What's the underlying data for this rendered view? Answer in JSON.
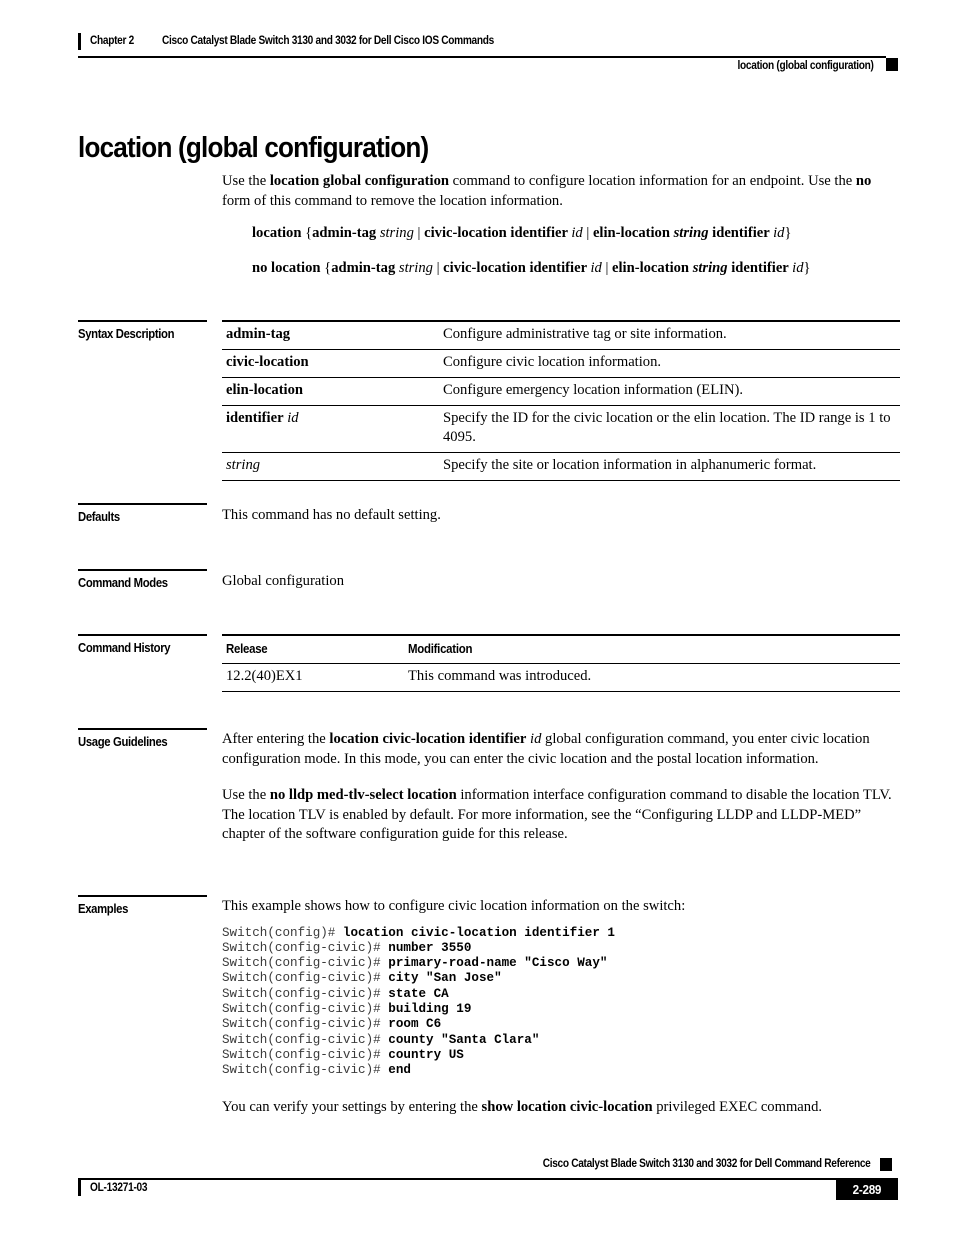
{
  "header": {
    "chapter": "Chapter 2",
    "chapter_title": "Cisco Catalyst Blade Switch 3130 and 3032 for Dell Cisco IOS Commands",
    "running_head": "location (global configuration)"
  },
  "page_title": "location (global configuration)",
  "intro": {
    "part1": "Use the ",
    "bold1": "location global configuration",
    "part2": " command to configure location information for an endpoint. Use the ",
    "bold2": "no",
    "part3": " form of this command to remove the location information."
  },
  "syntax_lines": [
    {
      "id": "syntax-positive",
      "segments": [
        {
          "text": "location ",
          "style": "bold"
        },
        {
          "text": "{",
          "style": "normal"
        },
        {
          "text": "admin-tag ",
          "style": "bold"
        },
        {
          "text": "string",
          "style": "italic"
        },
        {
          "text": " | ",
          "style": "normal"
        },
        {
          "text": "civic-location identifier ",
          "style": "bold"
        },
        {
          "text": "id",
          "style": "italic"
        },
        {
          "text": " | ",
          "style": "normal"
        },
        {
          "text": "elin-location ",
          "style": "bold"
        },
        {
          "text": "string",
          "style": "bolditalic"
        },
        {
          "text": " identifier ",
          "style": "bold"
        },
        {
          "text": "id",
          "style": "italic"
        },
        {
          "text": "}",
          "style": "normal"
        }
      ]
    },
    {
      "id": "syntax-negative",
      "segments": [
        {
          "text": "no location ",
          "style": "bold"
        },
        {
          "text": "{",
          "style": "normal"
        },
        {
          "text": "admin-tag ",
          "style": "bold"
        },
        {
          "text": "string",
          "style": "italic"
        },
        {
          "text": " | ",
          "style": "normal"
        },
        {
          "text": "civic-location identifier ",
          "style": "bold"
        },
        {
          "text": "id",
          "style": "italic"
        },
        {
          "text": " | ",
          "style": "normal"
        },
        {
          "text": "elin-location ",
          "style": "bold"
        },
        {
          "text": "string",
          "style": "bolditalic"
        },
        {
          "text": " identifier ",
          "style": "bold"
        },
        {
          "text": "id",
          "style": "italic"
        },
        {
          "text": "}",
          "style": "normal"
        }
      ]
    }
  ],
  "sections": {
    "syntax_description": {
      "label": "Syntax Description",
      "rows": [
        {
          "term": "admin-tag",
          "term_italic_suffix": "",
          "description": "Configure administrative tag or site information."
        },
        {
          "term": "civic-location",
          "term_italic_suffix": "",
          "description": "Configure civic location information."
        },
        {
          "term": "elin-location",
          "term_italic_suffix": "",
          "description": "Configure emergency location information (ELIN)."
        },
        {
          "term": "identifier",
          "term_italic_suffix": "id",
          "description": "Specify the ID for the civic location or the elin location. The ID range is 1 to 4095."
        },
        {
          "term_italic_only": "string",
          "description": "Specify the site or location information in alphanumeric format."
        }
      ]
    },
    "defaults": {
      "label": "Defaults",
      "text": "This command has no default setting."
    },
    "command_modes": {
      "label": "Command Modes",
      "text": "Global configuration"
    },
    "command_history": {
      "label": "Command History",
      "columns": [
        "Release",
        "Modification"
      ],
      "rows": [
        {
          "release": "12.2(40)EX1",
          "modification": "This command was introduced."
        }
      ]
    },
    "usage_guidelines": {
      "label": "Usage Guidelines",
      "paragraph1": {
        "part1": "After entering the ",
        "bold1": "location civic-location identifier",
        "italic1": " id",
        "part2": " global configuration command, you enter civic location configuration mode. In this mode, you can enter the civic location and the postal location information."
      },
      "paragraph2": {
        "part1": "Use the ",
        "bold1": "no lldp med-tlv-select location",
        "part2": " information interface configuration command to disable the location TLV. The location TLV is enabled by default. For more information, see the “Configuring LLDP and LLDP-MED” chapter of the software configuration guide for this release."
      }
    },
    "examples": {
      "label": "Examples",
      "intro": "This example shows how to configure civic location information on the switch:",
      "cli_lines": [
        {
          "prompt": "Switch(config)# ",
          "command": "location civic-location identifier 1"
        },
        {
          "prompt": "Switch(config-civic)# ",
          "command": "number 3550"
        },
        {
          "prompt": "Switch(config-civic)# ",
          "command": "primary-road-name \"Cisco Way\""
        },
        {
          "prompt": "Switch(config-civic)# ",
          "command": "city \"San Jose\""
        },
        {
          "prompt": "Switch(config-civic)# ",
          "command": "state CA"
        },
        {
          "prompt": "Switch(config-civic)# ",
          "command": "building 19"
        },
        {
          "prompt": "Switch(config-civic)# ",
          "command": "room C6"
        },
        {
          "prompt": "Switch(config-civic)# ",
          "command": "county \"Santa Clara\""
        },
        {
          "prompt": "Switch(config-civic)# ",
          "command": "country US"
        },
        {
          "prompt": "Switch(config-civic)# ",
          "command": "end"
        }
      ],
      "verify": {
        "part1": "You can verify your settings by entering the ",
        "bold1": "show location civic-location",
        "part2": " privileged EXEC command."
      }
    }
  },
  "footer": {
    "title": "Cisco Catalyst Blade Switch 3130 and 3032 for Dell Command Reference",
    "doc_id": "OL-13271-03",
    "page_number": "2-289"
  }
}
